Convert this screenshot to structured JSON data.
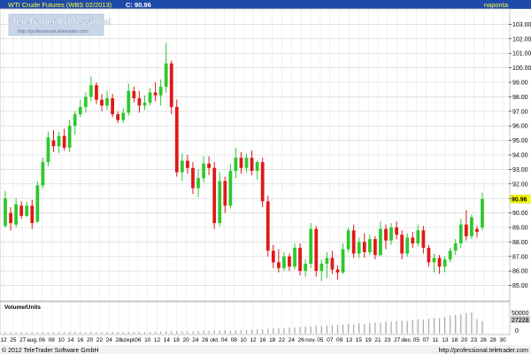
{
  "header": {
    "title": "WTI Crude Futures (WBS 02/2013)",
    "close_label": "C: 90.96",
    "period": "naponta"
  },
  "watermark": {
    "brand": "TeleTrader Professional",
    "url": "http://professional.teletrader.com"
  },
  "footer": {
    "copyright": "© 2012 TeleTrader Software GmbH",
    "url": "http://professional.teletrader.com"
  },
  "volume_panel": {
    "title": "Volume/Units",
    "last_value": "27228",
    "ticks": [
      "50000",
      "0"
    ]
  },
  "colors": {
    "up": "#2ec82e",
    "down": "#e01818",
    "volume": "#a8a8a8",
    "price_tag_bg": "#ffff00"
  },
  "price_tag": "90.96",
  "chart_data": {
    "type": "candlestick",
    "ylim": [
      84,
      104
    ],
    "y_ticks": [
      "85.00",
      "86.00",
      "87.00",
      "88.00",
      "89.00",
      "90.00",
      "91.00",
      "92.00",
      "93.00",
      "94.00",
      "95.00",
      "96.00",
      "97.00",
      "98.00",
      "99.00",
      "100.00",
      "101.00",
      "102.00",
      "103.00"
    ],
    "x_tick_labels": [
      "12",
      "25",
      "27",
      "aug.",
      "06",
      "08",
      "10",
      "14",
      "16",
      "20",
      "22",
      "24",
      "28",
      "szept.",
      "06",
      "10",
      "12",
      "14",
      "18",
      "20",
      "24",
      "26",
      "okt.",
      "04",
      "08",
      "10",
      "12",
      "16",
      "18",
      "22",
      "24",
      "26",
      "nov.",
      "05",
      "07",
      "09",
      "13",
      "15",
      "19",
      "21",
      "23",
      "27",
      "dec.",
      "05",
      "07",
      "11",
      "13",
      "18",
      "20",
      "23",
      "26",
      "28",
      "30"
    ],
    "candles": [
      {
        "o": 89.1,
        "h": 91.5,
        "l": 89.0,
        "c": 91.0
      },
      {
        "o": 90.0,
        "h": 90.4,
        "l": 88.8,
        "c": 89.3
      },
      {
        "o": 89.2,
        "h": 91.0,
        "l": 89.0,
        "c": 90.6
      },
      {
        "o": 90.5,
        "h": 90.8,
        "l": 89.6,
        "c": 89.8
      },
      {
        "o": 89.8,
        "h": 90.8,
        "l": 89.7,
        "c": 90.5
      },
      {
        "o": 90.5,
        "h": 90.9,
        "l": 88.9,
        "c": 89.3
      },
      {
        "o": 89.4,
        "h": 92.2,
        "l": 89.3,
        "c": 91.9
      },
      {
        "o": 91.9,
        "h": 93.8,
        "l": 91.7,
        "c": 93.5
      },
      {
        "o": 93.5,
        "h": 95.6,
        "l": 93.2,
        "c": 95.2
      },
      {
        "o": 95.0,
        "h": 95.7,
        "l": 94.2,
        "c": 94.6
      },
      {
        "o": 94.6,
        "h": 95.6,
        "l": 94.1,
        "c": 95.3
      },
      {
        "o": 95.3,
        "h": 95.8,
        "l": 94.3,
        "c": 94.5
      },
      {
        "o": 94.5,
        "h": 96.4,
        "l": 94.2,
        "c": 96.0
      },
      {
        "o": 96.0,
        "h": 97.0,
        "l": 95.4,
        "c": 96.8
      },
      {
        "o": 96.8,
        "h": 97.8,
        "l": 96.6,
        "c": 97.3
      },
      {
        "o": 97.3,
        "h": 98.3,
        "l": 96.9,
        "c": 98.0
      },
      {
        "o": 98.0,
        "h": 99.4,
        "l": 97.7,
        "c": 98.8
      },
      {
        "o": 98.8,
        "h": 99.0,
        "l": 97.5,
        "c": 97.8
      },
      {
        "o": 97.8,
        "h": 98.2,
        "l": 97.0,
        "c": 97.4
      },
      {
        "o": 97.4,
        "h": 98.4,
        "l": 97.1,
        "c": 97.9
      },
      {
        "o": 97.9,
        "h": 98.2,
        "l": 96.6,
        "c": 96.8
      },
      {
        "o": 96.8,
        "h": 97.0,
        "l": 96.2,
        "c": 96.4
      },
      {
        "o": 96.4,
        "h": 97.2,
        "l": 96.2,
        "c": 96.9
      },
      {
        "o": 96.9,
        "h": 98.9,
        "l": 96.7,
        "c": 98.4
      },
      {
        "o": 98.4,
        "h": 98.7,
        "l": 97.6,
        "c": 97.9
      },
      {
        "o": 97.9,
        "h": 98.4,
        "l": 96.9,
        "c": 97.4
      },
      {
        "o": 97.4,
        "h": 98.1,
        "l": 97.1,
        "c": 97.6
      },
      {
        "o": 97.6,
        "h": 98.6,
        "l": 97.4,
        "c": 98.3
      },
      {
        "o": 98.3,
        "h": 99.0,
        "l": 97.7,
        "c": 98.1
      },
      {
        "o": 98.1,
        "h": 99.2,
        "l": 97.4,
        "c": 98.7
      },
      {
        "o": 98.7,
        "h": 101.7,
        "l": 98.3,
        "c": 100.3
      },
      {
        "o": 100.3,
        "h": 100.5,
        "l": 96.8,
        "c": 97.3
      },
      {
        "o": 97.3,
        "h": 97.8,
        "l": 92.5,
        "c": 92.8
      },
      {
        "o": 92.8,
        "h": 94.1,
        "l": 92.2,
        "c": 93.6
      },
      {
        "o": 93.6,
        "h": 94.0,
        "l": 92.7,
        "c": 93.1
      },
      {
        "o": 93.1,
        "h": 93.5,
        "l": 91.3,
        "c": 91.7
      },
      {
        "o": 91.7,
        "h": 93.0,
        "l": 91.1,
        "c": 92.4
      },
      {
        "o": 92.4,
        "h": 93.9,
        "l": 92.1,
        "c": 93.4
      },
      {
        "o": 93.4,
        "h": 93.9,
        "l": 92.6,
        "c": 93.1
      },
      {
        "o": 93.1,
        "h": 93.5,
        "l": 88.9,
        "c": 89.3
      },
      {
        "o": 89.3,
        "h": 92.8,
        "l": 89.1,
        "c": 92.2
      },
      {
        "o": 92.2,
        "h": 92.5,
        "l": 90.0,
        "c": 90.5
      },
      {
        "o": 90.5,
        "h": 93.4,
        "l": 90.3,
        "c": 92.9
      },
      {
        "o": 92.9,
        "h": 94.5,
        "l": 92.4,
        "c": 93.8
      },
      {
        "o": 93.8,
        "h": 94.2,
        "l": 92.7,
        "c": 93.1
      },
      {
        "o": 93.1,
        "h": 94.1,
        "l": 92.8,
        "c": 93.8
      },
      {
        "o": 93.8,
        "h": 94.3,
        "l": 92.6,
        "c": 92.9
      },
      {
        "o": 92.9,
        "h": 93.6,
        "l": 92.3,
        "c": 93.5
      },
      {
        "o": 93.5,
        "h": 93.8,
        "l": 90.4,
        "c": 90.8
      },
      {
        "o": 90.8,
        "h": 91.2,
        "l": 87.0,
        "c": 87.4
      },
      {
        "o": 87.4,
        "h": 87.8,
        "l": 86.2,
        "c": 86.6
      },
      {
        "o": 86.6,
        "h": 87.5,
        "l": 85.9,
        "c": 86.2
      },
      {
        "o": 86.2,
        "h": 87.3,
        "l": 86.0,
        "c": 87.0
      },
      {
        "o": 87.0,
        "h": 87.2,
        "l": 86.0,
        "c": 86.3
      },
      {
        "o": 86.3,
        "h": 87.9,
        "l": 86.1,
        "c": 87.6
      },
      {
        "o": 87.6,
        "h": 87.9,
        "l": 85.7,
        "c": 86.0
      },
      {
        "o": 86.0,
        "h": 86.8,
        "l": 85.6,
        "c": 86.5
      },
      {
        "o": 86.5,
        "h": 89.3,
        "l": 86.2,
        "c": 88.9
      },
      {
        "o": 88.9,
        "h": 89.1,
        "l": 85.6,
        "c": 86.0
      },
      {
        "o": 86.0,
        "h": 86.8,
        "l": 85.3,
        "c": 86.5
      },
      {
        "o": 86.5,
        "h": 87.3,
        "l": 85.5,
        "c": 86.9
      },
      {
        "o": 86.9,
        "h": 87.4,
        "l": 85.8,
        "c": 86.1
      },
      {
        "o": 86.1,
        "h": 86.4,
        "l": 85.4,
        "c": 85.9
      },
      {
        "o": 85.9,
        "h": 87.9,
        "l": 85.8,
        "c": 87.5
      },
      {
        "o": 87.5,
        "h": 89.0,
        "l": 87.3,
        "c": 88.8
      },
      {
        "o": 88.8,
        "h": 89.2,
        "l": 86.9,
        "c": 87.2
      },
      {
        "o": 87.2,
        "h": 88.3,
        "l": 86.9,
        "c": 88.0
      },
      {
        "o": 88.0,
        "h": 88.6,
        "l": 86.9,
        "c": 87.3
      },
      {
        "o": 87.3,
        "h": 88.5,
        "l": 87.1,
        "c": 88.2
      },
      {
        "o": 88.2,
        "h": 88.4,
        "l": 86.8,
        "c": 87.1
      },
      {
        "o": 87.1,
        "h": 89.4,
        "l": 87.0,
        "c": 88.9
      },
      {
        "o": 88.9,
        "h": 89.2,
        "l": 87.5,
        "c": 88.1
      },
      {
        "o": 88.1,
        "h": 89.3,
        "l": 87.8,
        "c": 89.0
      },
      {
        "o": 89.0,
        "h": 89.4,
        "l": 88.2,
        "c": 88.5
      },
      {
        "o": 88.5,
        "h": 88.8,
        "l": 86.8,
        "c": 87.2
      },
      {
        "o": 87.2,
        "h": 88.6,
        "l": 87.0,
        "c": 88.3
      },
      {
        "o": 88.3,
        "h": 88.7,
        "l": 87.6,
        "c": 87.9
      },
      {
        "o": 87.9,
        "h": 89.2,
        "l": 87.7,
        "c": 88.8
      },
      {
        "o": 88.8,
        "h": 89.1,
        "l": 87.2,
        "c": 87.6
      },
      {
        "o": 87.6,
        "h": 87.8,
        "l": 86.3,
        "c": 86.6
      },
      {
        "o": 86.6,
        "h": 87.2,
        "l": 85.9,
        "c": 86.9
      },
      {
        "o": 86.9,
        "h": 87.1,
        "l": 85.8,
        "c": 86.3
      },
      {
        "o": 86.3,
        "h": 87.0,
        "l": 85.9,
        "c": 86.8
      },
      {
        "o": 86.8,
        "h": 87.6,
        "l": 86.6,
        "c": 87.4
      },
      {
        "o": 87.4,
        "h": 88.2,
        "l": 87.1,
        "c": 87.9
      },
      {
        "o": 87.9,
        "h": 89.6,
        "l": 87.6,
        "c": 89.2
      },
      {
        "o": 89.2,
        "h": 90.2,
        "l": 88.1,
        "c": 88.4
      },
      {
        "o": 88.4,
        "h": 89.9,
        "l": 88.2,
        "c": 89.7
      },
      {
        "o": 88.9,
        "h": 89.1,
        "l": 88.3,
        "c": 88.7
      },
      {
        "o": 89.0,
        "h": 91.4,
        "l": 88.8,
        "c": 90.96
      }
    ],
    "volume": [
      3200,
      3100,
      3000,
      3300,
      2900,
      3100,
      3500,
      3600,
      3800,
      3400,
      3300,
      3600,
      3700,
      3900,
      3500,
      3400,
      3800,
      3600,
      3300,
      3500,
      3600,
      3700,
      3400,
      3900,
      4100,
      3800,
      3600,
      3900,
      4200,
      4600,
      4800,
      5200,
      5600,
      5100,
      4900,
      5300,
      5800,
      6200,
      5700,
      6400,
      6800,
      7200,
      6600,
      7100,
      7600,
      8100,
      8800,
      9300,
      9800,
      10500,
      11200,
      11800,
      12500,
      13400,
      12800,
      14200,
      15100,
      16000,
      17200,
      16400,
      17800,
      18500,
      19400,
      20200,
      21000,
      20100,
      22400,
      21500,
      23100,
      24200,
      23600,
      25800,
      26500,
      27200,
      28400,
      27600,
      29800,
      31200,
      30400,
      32600,
      34100,
      33500,
      36200,
      38800,
      40500,
      42600,
      44800,
      46200,
      31500,
      27228
    ]
  }
}
